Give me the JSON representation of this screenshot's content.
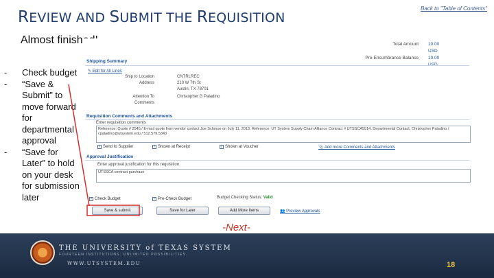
{
  "header": {
    "title_caps_1": "R",
    "title_rest_1": "EVIEW AND ",
    "title_caps_2": "S",
    "title_rest_2": "UBMIT THE ",
    "title_caps_3": "R",
    "title_rest_3": "EQUISITION",
    "toc_link": "Back to \"Table of Contents\""
  },
  "subtitle": "Almost finished!",
  "bullets": [
    {
      "dash": "-",
      "text": "Check budget"
    },
    {
      "dash": "-",
      "text": "“Save & Submit” to move forward for departmental approval"
    },
    {
      "dash": "-",
      "text": "“Save for Later” to hold on your desk for submission later"
    }
  ],
  "screenshot": {
    "totals": {
      "total_amount_label": "Total Amount",
      "total_amount_value": "10.00 USD",
      "pre_encumbrance_label": "Pre-Encumbrance Balance",
      "pre_encumbrance_value": "10.00 USD"
    },
    "shipping": {
      "section_title": "Shipping Summary",
      "edit_all_link": "Edit for All Lines",
      "ship_to_label": "Ship to Location",
      "ship_to_value": "CNTRLREC",
      "address_label": "Address",
      "address_line1": "210 W 7th St",
      "address_line2": "Austin, TX 78701",
      "attention_label": "Attention To",
      "attention_value": "Christopher G Paladino",
      "comments_label": "Comments"
    },
    "comments": {
      "section_title": "Requisition Comments and Attachments",
      "prompt": "Enter requisition comments",
      "text": "Reference: Quote # 2545 / E-mail quote from vendor contact Joe Schmoe on July 11, 2013. Reference: UT System Supply Chain Alliance Contract # UTSSCA5514. Departmental Contact: Christopher Paladino / cpaladino@utsystem.edu / 512.579.5343",
      "send_to_supplier": "Send to Supplier",
      "show_at_receipt": "Shown at Receipt",
      "show_at_voucher": "Shown at Voucher",
      "add_comments_link": "Add more Comments and Attachments"
    },
    "approval": {
      "section_title": "Approval Justification",
      "prompt": "Enter approval justification for this requisition",
      "text": "UTSSCA contract purchase",
      "check_budget_label": "Check Budget",
      "precheck_budget_label": "Pre-Check Budget",
      "budget_status_label": "Budget Checking Status:",
      "budget_status_value": "Valid",
      "save_submit_button": "Save & submit",
      "save_later_button": "Save for Later",
      "add_more_items_button": "Add More Items",
      "preview_approvals_link": "Preview Approvals"
    }
  },
  "next_label": "-Next-",
  "footer": {
    "university_name": "THE UNIVERSITY of TEXAS SYSTEM",
    "tagline": "FOURTEEN INSTITUTIONS. UNLIMITED POSSIBILITIES.",
    "url": "WWW.UTSYSTEM.EDU",
    "page_number": "18"
  },
  "colors": {
    "title": "#1f3e6e",
    "accent_red": "#c0392b",
    "footer_bg": "#1b2a40",
    "page_number": "#e8c33a"
  }
}
